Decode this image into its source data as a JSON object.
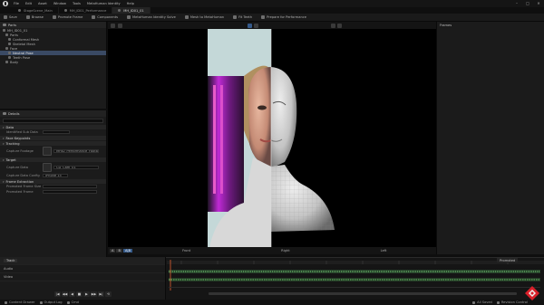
{
  "menubar": {
    "items": [
      "File",
      "Edit",
      "Asset",
      "Window",
      "Tools",
      "MetaHuman Identity",
      "Help"
    ],
    "window_controls": [
      "–",
      "□",
      "✕"
    ]
  },
  "tabs": [
    {
      "label": "StageScene_Main",
      "active": false
    },
    {
      "label": "MH_ID01_Performance",
      "active": false
    },
    {
      "label": "MH_ID01_01",
      "active": true
    }
  ],
  "toolbar": {
    "items": [
      "Save",
      "Browse",
      "Promote Frame",
      "Components",
      "MetaHuman Identity Solve",
      "Mesh to MetaHuman",
      "Fit Teeth",
      "Prepare for Performance"
    ]
  },
  "outliner": {
    "title": "Parts",
    "items": [
      {
        "label": "MH_ID01_01",
        "selected": false,
        "indent": 0
      },
      {
        "label": "Parts",
        "selected": false,
        "indent": 1
      },
      {
        "label": "Conformal Mesh",
        "selected": false,
        "indent": 2
      },
      {
        "label": "Skeletal Mesh",
        "selected": false,
        "indent": 2
      },
      {
        "label": "Face",
        "selected": false,
        "indent": 1
      },
      {
        "label": "Neutral Pose",
        "selected": true,
        "indent": 2
      },
      {
        "label": "Teeth Pose",
        "selected": false,
        "indent": 2
      },
      {
        "label": "Body",
        "selected": false,
        "indent": 1
      }
    ]
  },
  "details": {
    "title": "Details",
    "sections": [
      {
        "name": "Data",
        "props": [
          {
            "label": "Identified Sub Data",
            "value": ""
          }
        ]
      },
      {
        "name": "Face Keypoints",
        "props": []
      },
      {
        "name": "Tracking",
        "props": [
          {
            "label": "Capture Footage",
            "value": "MHID_Performance_Footage"
          }
        ]
      },
      {
        "name": "Target",
        "props": [
          {
            "label": "Capture Data",
            "value": "CD_Cam_01"
          },
          {
            "label": "Capture Data Config",
            "value": "iPhone 15"
          }
        ]
      },
      {
        "name": "Frame Extraction",
        "props": [
          {
            "label": "Promoted Frame Size",
            "value": ""
          },
          {
            "label": "Promoted Frame",
            "value": ""
          }
        ]
      }
    ]
  },
  "viewport": {
    "labels": [
      "Front",
      "Right",
      "Left"
    ],
    "buttons": [
      "A",
      "B",
      "A|B"
    ]
  },
  "right_panel": {
    "title": "Frames"
  },
  "timeline": {
    "panel_title": "Track",
    "tracks": [
      "Audio",
      "Video"
    ],
    "transport": [
      "|◀",
      "◀◀",
      "◀",
      "■",
      "▶",
      "▶▶",
      "▶|",
      "⟲"
    ],
    "dropdown": "Promoted"
  },
  "statusbar": {
    "items": [
      "Content Drawer",
      "Output Log",
      "Cmd"
    ],
    "right_items": [
      "All Saved",
      "Revision Control"
    ]
  },
  "colors": {
    "accent": "#3a4a64",
    "brand_red": "#d9202a"
  }
}
